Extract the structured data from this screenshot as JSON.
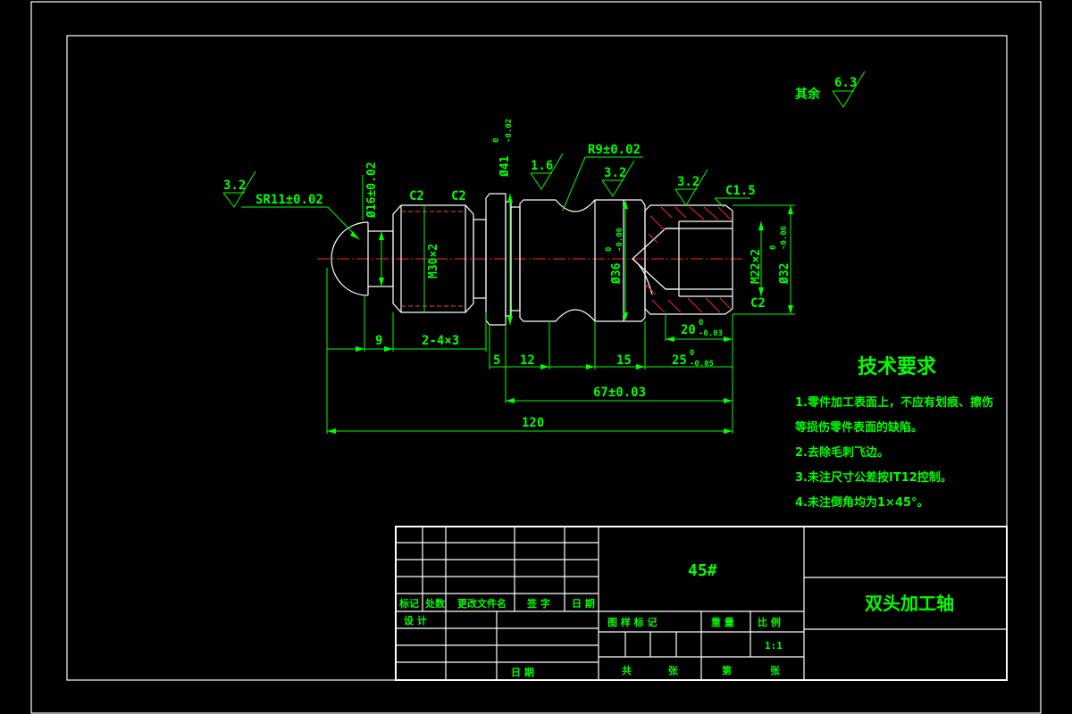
{
  "roughness": {
    "other_label": "其余",
    "other_value": "6.3",
    "left_end": "3.2",
    "collar": "1.6",
    "mid": "3.2",
    "right_end": "3.2"
  },
  "dimensions": {
    "sr11": "SR11±0.02",
    "d16": "Ø16±0.02",
    "c2_a": "C2",
    "c2_b": "C2",
    "d41": "Ø41",
    "d41_tol_up": "0",
    "d41_tol_low": "-0.02",
    "r9": "R9±0.02",
    "c15": "C1.5",
    "m30": "M30×2",
    "d36": "Ø36",
    "d36_tol_up": "0",
    "d36_tol_low": "-0.06",
    "m22": "M22×2",
    "d32": "Ø32",
    "d32_tol_up": "0",
    "d32_tol_low": "-0.06",
    "c2_c": "C2",
    "l9": "9",
    "l2x4x3": "2-4×3",
    "l5": "5",
    "l12": "12",
    "l15": "15",
    "l20": "20",
    "l20_tol_up": "0",
    "l20_tol_low": "-0.03",
    "l25": "25",
    "l25_tol_up": "0",
    "l25_tol_low": "-0.05",
    "l67": "67±0.03",
    "l120": "120"
  },
  "tech": {
    "title": "技术要求",
    "line1": "1.零件加工表面上，不应有划痕、擦伤",
    "line2": "等损伤零件表面的缺陷。",
    "line3": "2.去除毛刺飞边。",
    "line4": "3.未注尺寸公差按IT12控制。",
    "line5": "4.未注倒角均为1×45°。"
  },
  "title_block": {
    "material": "45#",
    "part_name": "双头加工轴",
    "h_mark": "标记",
    "h_count": "处数",
    "h_doc": "更改文件名",
    "h_sign": "签 字",
    "h_date": "日 期",
    "design": "设 计",
    "date": "日 期",
    "drawing_mark": "图 样 标 记",
    "weight": "重 量",
    "scale_label": "比 例",
    "scale": "1:1",
    "sheet_total": "共",
    "sheet_total_unit": "张",
    "sheet_no": "第",
    "sheet_no_unit": "张"
  }
}
